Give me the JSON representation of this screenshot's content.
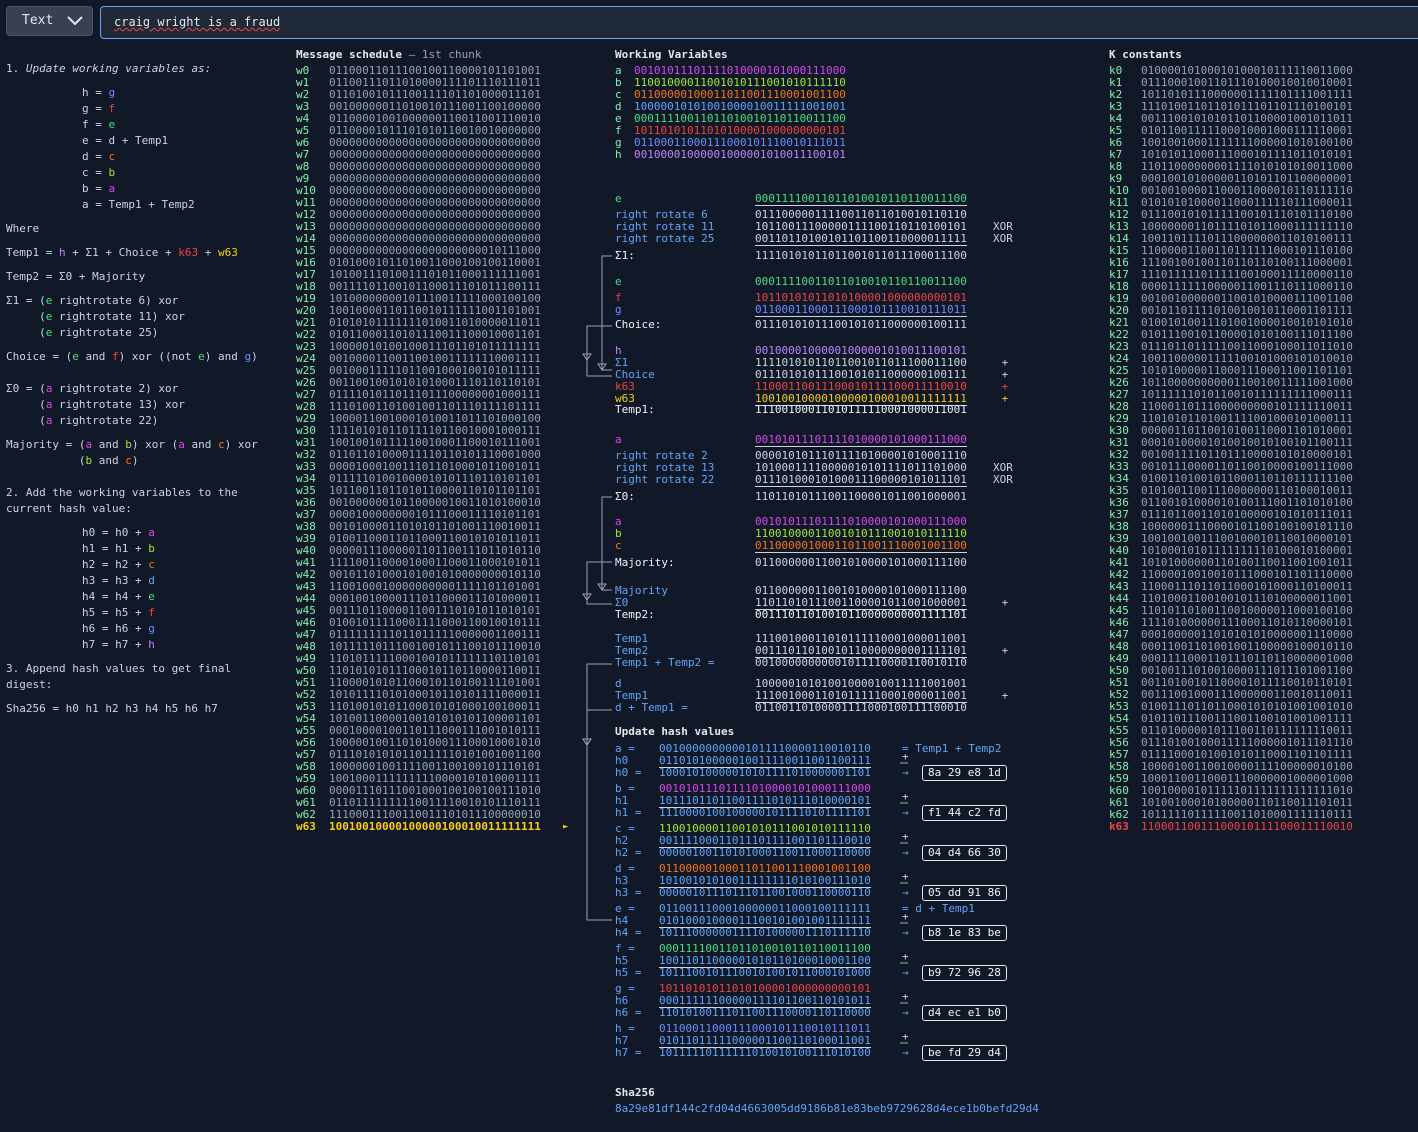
{
  "toolbar": {
    "mode_label": "Text",
    "input_value": "craig wright is a fraud"
  },
  "explain": {
    "step1_num": "1. ",
    "step1_text": "Update working variables as:",
    "assign": [
      [
        "h = ",
        "g",
        "c-g"
      ],
      [
        "g = ",
        "f",
        "c-f"
      ],
      [
        "f = ",
        "e",
        "c-e"
      ],
      [
        "e = ",
        "d + Temp1",
        ""
      ],
      [
        "d = ",
        "c",
        "c-c"
      ],
      [
        "c = ",
        "b",
        "c-b"
      ],
      [
        "b = ",
        "a",
        "c-a"
      ],
      [
        "a = ",
        "Temp1 + Temp2",
        ""
      ]
    ],
    "where": "Where",
    "step2_line1": "2. Add the working variables to the",
    "step2_line2": "current hash value:",
    "hash_adds": [
      [
        "h0 = h0 + ",
        "a",
        "c-a"
      ],
      [
        "h1 = h1 + ",
        "b",
        "c-b"
      ],
      [
        "h2 = h2 + ",
        "c",
        "c-c"
      ],
      [
        "h3 = h3 + ",
        "d",
        "c-d"
      ],
      [
        "h4 = h4 + ",
        "e",
        "c-e"
      ],
      [
        "h5 = h5 + ",
        "f",
        "c-f"
      ],
      [
        "h6 = h6 + ",
        "g",
        "c-g"
      ],
      [
        "h7 = h7 + ",
        "h",
        "c-h"
      ]
    ],
    "step3_line1": "3. Append hash values to get final",
    "step3_line2": "digest:",
    "sha_formula": "Sha256 = h0 h1 h2 h3 h4 h5 h6 h7"
  },
  "schedule": {
    "title": "Message schedule",
    "subtitle": " – 1st chunk",
    "rows": [
      "01100011011100100110000101101001",
      "01100111011010000111101110111011",
      "01101001011100111101101000011101",
      "00100000011010010111001100100000",
      "01100001001000000110011001110010",
      "01100001011101010110010010000000",
      "00000000000000000000000000000000",
      "00000000000000000000000000000000",
      "00000000000000000000000000000000",
      "00000000000000000000000000000000",
      "00000000000000000000000000000000",
      "00000000000000000000000000000000",
      "00000000000000000000000000000000",
      "00000000000000000000000000000000",
      "00000000000000000000000000000000",
      "00000000000000000000000010111000",
      "01010001011010011000100100110001",
      "10100111010011101011000111111001",
      "00111101100101100011101011100111",
      "10100000000101110011111000100100",
      "10010000110110010111111001101001",
      "01010101111111010011010000011011",
      "01011000110101110011100010001101",
      "10000010100100011101101011111111",
      "00100001100110010011111110001111",
      "00100011111011001000100101011111",
      "00110010010101010001110110110101",
      "01111010110111011100000001000111",
      "11101001101001001101110111101111",
      "10000110010001010011011101000100",
      "11110101011011110110010001000111",
      "10010010111110010001100010111001",
      "01101101000011110110101110001000",
      "00001000100111011010001011001011",
      "01111101001000010101110110101101",
      "10110011011010110000110101101101",
      "00100000010110000010011010100010",
      "00001000000001011100011110101101",
      "00101000011010101101001110010011",
      "01001100011011000110010101011011",
      "00000111000001101100111011010110",
      "11110011000010001100011000101011",
      "00101101000101001010000000010110",
      "11001000100000000001111101101001",
      "00010010000111011000011101000011",
      "00111011000011001110101011010101",
      "01001011110001111000110010010111",
      "01111111110110111110000001100111",
      "10111110111001001011100101110010",
      "11010111110001001011111110110101",
      "11010101011100010110110000110011",
      "11000010101100010110100111101001",
      "10101111010100010110101111000011",
      "11010010101100010101000100100011",
      "10100110000100101010101100001101",
      "00010000100110111000111001010111",
      "10000010011010100011100010001010",
      "01110101010110111110101001001100",
      "10000001001111001100100101110101",
      "10010001111111110000101010001111",
      "00001110111001000100100100111010",
      "01101111111110011110010101110111",
      "11100011100110011101011100000010",
      "10010010000100000100010011111111"
    ]
  },
  "working": {
    "title": "Working Variables",
    "rows": [
      [
        "a",
        "00101011101111010000101000111000",
        "c-a"
      ],
      [
        "b",
        "11001000011001010111001010111110",
        "c-b"
      ],
      [
        "c",
        "01100000100011011001110001001100",
        "c-c"
      ],
      [
        "d",
        "10000010101001000010011111001001",
        "c-d"
      ],
      [
        "e",
        "00011110011011010010110110011100",
        "c-e"
      ],
      [
        "f",
        "10110101011010100001000000000101",
        "c-f"
      ],
      [
        "g",
        "01100011000111000101110010111011",
        "c-g"
      ],
      [
        "h",
        "00100001000001000001010011100101",
        "c-h"
      ]
    ]
  },
  "sigma1": {
    "e_label": "e",
    "e_val": "00011110011011010010110110011100",
    "r6_label": "right rotate 6",
    "r6_val": "01110000011110011011010010110110",
    "r11_label": "right rotate 11",
    "r11_val": "10110011100000111100110110100101",
    "r25_label": "right rotate 25",
    "r25_val": "00110110100101101100110000011111",
    "xor": "XOR",
    "res_label": "Σ1:",
    "res_val": "11110101011011001011011100011100"
  },
  "choice": {
    "e_label": "e",
    "e_val": "00011110011011010010110110011100",
    "f_label": "f",
    "f_val": "10110101011010100001000000000101",
    "g_label": "g",
    "g_val": "01100011000111000101110010111011",
    "res_label": "Choice:",
    "res_val": "01110101011100101011000000100111"
  },
  "temp1": {
    "rows": [
      [
        "h",
        "00100001000001000001010011100101",
        "c-h",
        ""
      ],
      [
        "Σ1",
        "11110101011011001011011100011100",
        "",
        " +"
      ],
      [
        "Choice",
        "01110101011100101011000000100111",
        "",
        " +"
      ],
      [
        "k63",
        "11000110011100010111100011110010",
        "c-f",
        " +"
      ],
      [
        "w63",
        "10010010000100000100010011111111",
        "c-w",
        " +"
      ]
    ],
    "res_label": "Temp1:",
    "res_val": "11100100011010111110001000011001"
  },
  "sigma0": {
    "a_label": "a",
    "a_val": "00101011101111010000101000111000",
    "r2_label": "right rotate 2",
    "r2_val": "00001010111011110100001010001110",
    "r13_label": "right rotate 13",
    "r13_val": "10100011110000010101111011101000",
    "r22_label": "right rotate 22",
    "r22_val": "01110100010100011100000101011101",
    "xor": "XOR",
    "res_label": "Σ0:",
    "res_val": "11011010111001100001011001000001"
  },
  "majority": {
    "a_label": "a",
    "a_val": "00101011101111010000101000111000",
    "b_label": "b",
    "b_val": "11001000011001010111001010111110",
    "c_label": "c",
    "c_val": "01100000100011011001110001001100",
    "res_label": "Majority:",
    "res_val": "01100000011001010000101000111100"
  },
  "temp2": {
    "rows": [
      [
        "Majority",
        "01100000011001010000101000111100",
        ""
      ],
      [
        "Σ0",
        "11011010111001100001011001000001",
        " +"
      ]
    ],
    "res_label": "Temp2:",
    "res_val": "00111011010010110000000001111101"
  },
  "sum12": {
    "rows": [
      [
        "Temp1",
        "11100100011010111110001000011001",
        ""
      ],
      [
        "Temp2",
        "00111011010010110000000001111101",
        " +"
      ]
    ],
    "res_label": "Temp1 + Temp2 =",
    "res_val": "00100000000001011110000110010110"
  },
  "dplus": {
    "rows": [
      [
        "d",
        "10000010101001000010011111001001",
        ""
      ],
      [
        "Temp1",
        "11100100011010111110001000011001",
        " +"
      ]
    ],
    "res_label": "d + Temp1 =",
    "res_val": "01100110100001111000100111100010"
  },
  "update": {
    "title": "Update hash values",
    "blocks": [
      {
        "v": "a =",
        "vc": "",
        "val": "00100000000001011110000110010110",
        "valc": "",
        "note": "= Temp1 + Temp2",
        "h": "h0",
        "hval": "01101010000010011110011001100111",
        "res": "h0 =",
        "rval": "10001010000010101111010000001101",
        "hex": "8a 29 e8 1d"
      },
      {
        "v": "b =",
        "vc": "",
        "val": "00101011101111010000101000111000",
        "valc": "c-a",
        "note": "",
        "h": "h1",
        "hval": "10111011011001111010111010000101",
        "res": "h1 =",
        "rval": "11100001001000001011110101111101",
        "hex": "f1 44 c2 fd"
      },
      {
        "v": "c =",
        "vc": "",
        "val": "11001000011001010111001010111110",
        "valc": "c-b",
        "note": "",
        "h": "h2",
        "hval": "00111100011011101111001101110010",
        "res": "h2 =",
        "rval": "00000100110101000110011000110000",
        "hex": "04 d4 66 30"
      },
      {
        "v": "d =",
        "vc": "",
        "val": "01100000100011011001110001001100",
        "valc": "c-c",
        "note": "",
        "h": "h3",
        "hval": "10100101010011111111010100111010",
        "res": "h3 =",
        "rval": "00000101110111011001000110000110",
        "hex": "05 dd 91 86"
      },
      {
        "v": "e =",
        "vc": "",
        "val": "01100111000100000011000100111111",
        "valc": "",
        "note": "= d + Temp1",
        "h": "h4",
        "hval": "01010001000011100101001001111111",
        "res": "h4 =",
        "rval": "10111000000111101000001110111110",
        "hex": "b8 1e 83 be"
      },
      {
        "v": "f =",
        "vc": "",
        "val": "00011110011011010010110110011100",
        "valc": "c-e",
        "note": "",
        "h": "h5",
        "hval": "10011011000001010110100010001100",
        "res": "h5 =",
        "rval": "10111001011100101001011000101000",
        "hex": "b9 72 96 28"
      },
      {
        "v": "g =",
        "vc": "",
        "val": "10110101011010100001000000000101",
        "valc": "c-f",
        "note": "",
        "h": "h6",
        "hval": "00011111100000111101100110101011",
        "res": "h6 =",
        "rval": "11010100111011001110000110110000",
        "hex": "d4 ec e1 b0"
      },
      {
        "v": "h =",
        "vc": "",
        "val": "01100011000111000101110010111011",
        "valc": "c-g",
        "note": "",
        "h": "h7",
        "hval": "01011011111000001100110100011001",
        "res": "h7 =",
        "rval": "10111110111111010010100111010100",
        "hex": "be fd 29 d4"
      }
    ],
    "sha_label": "Sha256",
    "sha_value": "8a29e81df144c2fd04d4663005dd9186b81e83beb9729628d4ece1b0befd29d4"
  },
  "k": {
    "title": "K constants",
    "rows": [
      "01000010100010100010111110011000",
      "01110001001101110100010010010001",
      "10110101110000001111101111001111",
      "11101001101101011101101110100101",
      "00111001010101101100001001011011",
      "01011001111100010001000111110001",
      "10010010001111111000001010100100",
      "10101011000111000101111011010101",
      "11011000000001111010101010011000",
      "00010010100000110101101100000001",
      "00100100001100011000010110111110",
      "01010101000011000111110111000011",
      "01110010101111100101110101110100",
      "10000000110111101011000111111110",
      "10011011110111000000011010100111",
      "11000001100110111111000101110100",
      "11100100100110110110100111000001",
      "11101111101111100100011110000110",
      "00001111110000011001110111000110",
      "00100100000011001010000111001100",
      "00101101111010010010110001101111",
      "01001010011101001000010010101010",
      "01011100101100001010100111011100",
      "01110110111110011000100011011010",
      "10011000001111100101000101010010",
      "10101000001100011100011001101101",
      "10110000000000110010011111001000",
      "10111111010110010111111111000111",
      "11000110111000000000101111110011",
      "11010101101001111001000101000111",
      "00000110110010100110001101010001",
      "00010100001010010010100101100111",
      "00100111101101110000101010000101",
      "00101110000110110010000100111000",
      "01001101001011000110110111111100",
      "01010011001110000000110100010011",
      "01100101000010100111001101010100",
      "01110110011010100000101010111011",
      "10000001110000101100100100101110",
      "10010010011100100010110010000101",
      "10100010101111111110100010100001",
      "10101000000110100110011001001011",
      "11000010010010111000101101110000",
      "11000111011011000101000110100011",
      "11010001100100101110100000011001",
      "11010110100110010000011000100100",
      "11110100000011100011010110000101",
      "00010000011010101010000001110000",
      "00011001101001001100000100010110",
      "00011110001101110110110000001000",
      "00100111010010000111011101001100",
      "00110100101100001011110010110101",
      "00111001000111000000110010110011",
      "01001110110110001010101001001010",
      "01011011100111001100101001001111",
      "01101000001011100110111111110011",
      "01110100100011111000001011101110",
      "01111000101001010110001101101111",
      "10000100110010000111100000010100",
      "10001100110001110000001000001000",
      "10010000101111101111111111111010",
      "10100100010100000110110011101011",
      "10111110111110011010001111110111",
      "11000110011100010111100011110010"
    ]
  }
}
